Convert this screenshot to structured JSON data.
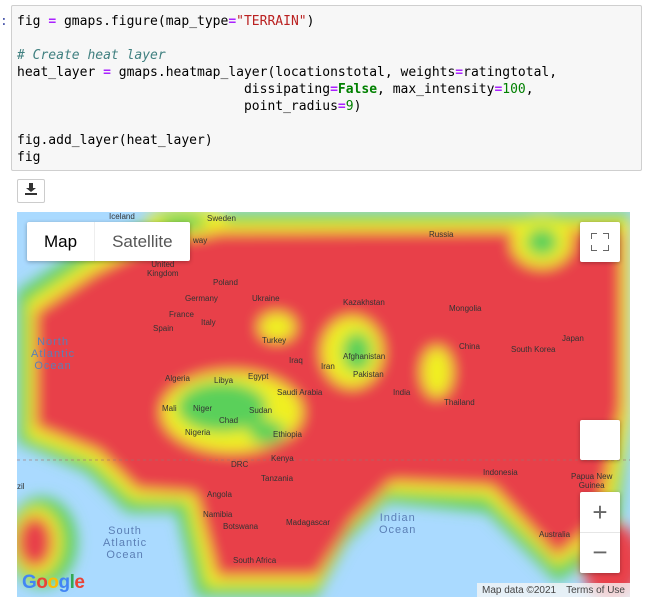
{
  "prompt": ":",
  "code": {
    "line1": {
      "a": "fig ",
      "eq": "=",
      "b": " gmaps.figure(map_type",
      "eq2": "=",
      "s": "\"TERRAIN\"",
      "c": ")"
    },
    "comment": "# Create heat layer",
    "line3": {
      "a": "heat_layer ",
      "eq": "=",
      "b": " gmaps.heatmap_layer(locationstotal, weights",
      "eq2": "=",
      "c": "ratingtotal,"
    },
    "line4": {
      "pad": "                             dissipating",
      "eq": "=",
      "kw": "False",
      "b": ", max_intensity",
      "eq2": "=",
      "n": "100",
      "c": ","
    },
    "line5": {
      "pad": "                             point_radius",
      "eq": "=",
      "n": "9",
      "c": ")"
    },
    "line6": "fig.add_layer(heat_layer)",
    "line7": "fig"
  },
  "map": {
    "type_buttons": {
      "map": "Map",
      "satellite": "Satellite"
    },
    "attribution": {
      "data": "Map data ©2021",
      "terms": "Terms of Use"
    },
    "logo": "Google",
    "icons": {
      "fullscreen": "fullscreen-icon",
      "zoom_in": "+",
      "zoom_out": "−",
      "download": "download-icon"
    },
    "colors": {
      "water": "#aadaff",
      "heat_high": "#e8404a",
      "heat_mid": "#f0f020",
      "heat_low": "#5ad05a"
    },
    "labels": {
      "iceland": "Iceland",
      "sweden": "Sweden",
      "norway": "way",
      "uk": "United\nKingdom",
      "poland": "Poland",
      "germany": "Germany",
      "ukraine": "Ukraine",
      "france": "France",
      "italy": "Italy",
      "spain": "Spain",
      "kazakhstan": "Kazakhstan",
      "russia": "Russia",
      "mongolia": "Mongolia",
      "turkey": "Turkey",
      "iraq": "Iraq",
      "iran": "Iran",
      "afghanistan": "Afghanistan",
      "pakistan": "Pakistan",
      "china": "China",
      "south_korea": "South Korea",
      "japan": "Japan",
      "algeria": "Algeria",
      "libya": "Libya",
      "egypt": "Egypt",
      "saudi": "Saudi Arabia",
      "india": "India",
      "thailand": "Thailand",
      "mali": "Mali",
      "niger": "Niger",
      "chad": "Chad",
      "sudan": "Sudan",
      "nigeria": "Nigeria",
      "ethiopia": "Ethiopia",
      "drc": "DRC",
      "kenya": "Kenya",
      "tanzania": "Tanzania",
      "angola": "Angola",
      "namibia": "Namibia",
      "botswana": "Botswana",
      "madagascar": "Madagascar",
      "south_africa": "South Africa",
      "indonesia": "Indonesia",
      "png": "Papua New\nGuinea",
      "australia": "Australia",
      "brazil": "zil"
    },
    "oceans": {
      "north_atlantic": "North\nAtlantic\nOcean",
      "south_atlantic": "South\nAtlantic\nOcean",
      "indian": "Indian\nOcean"
    }
  }
}
